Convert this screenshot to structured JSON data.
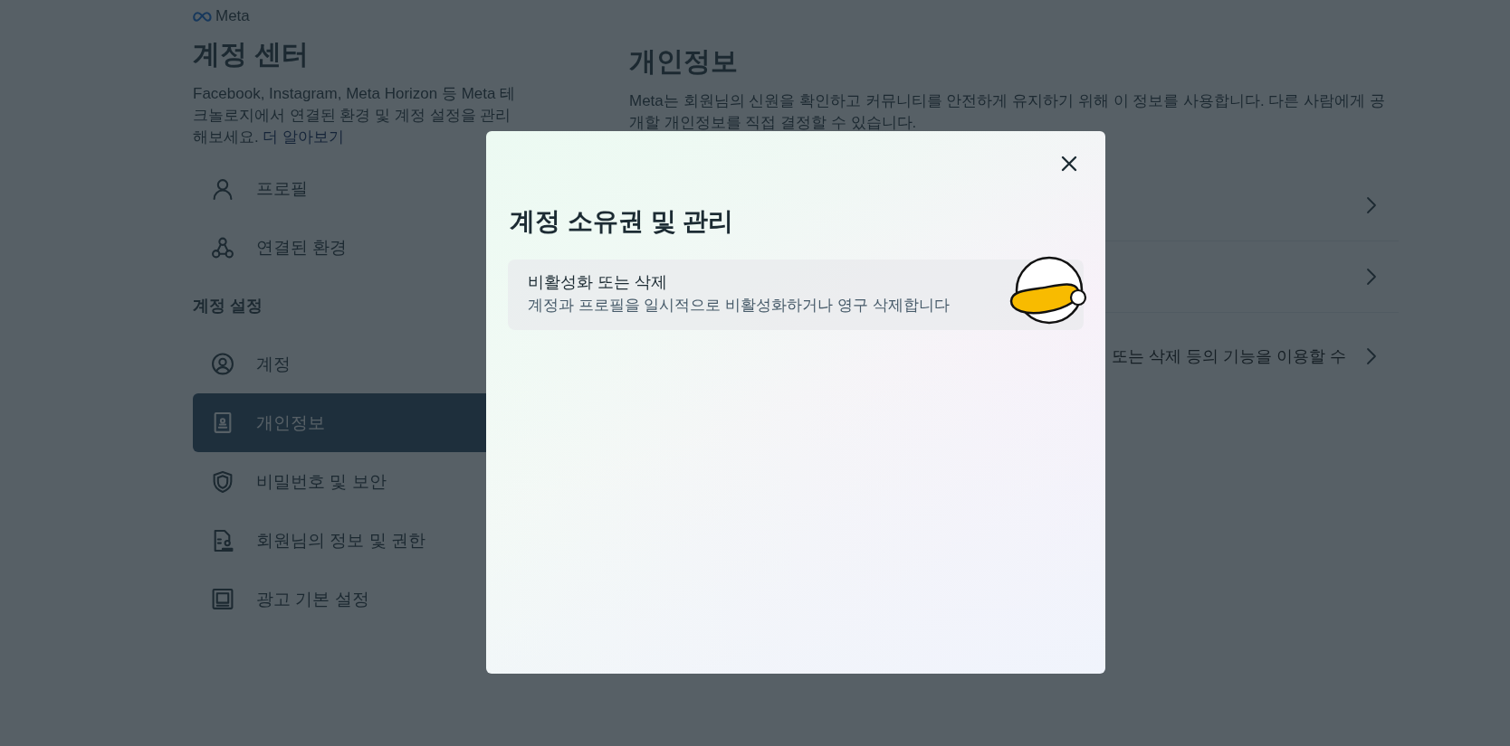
{
  "logo": {
    "text": "Meta"
  },
  "sidebar": {
    "title": "계정 센터",
    "description": "Facebook, Instagram, Meta Horizon 등 Meta 테크놀로지에서 연결된 환경 및 계정 설정을 관리해보세요.",
    "link": "더 알아보기",
    "items": [
      {
        "kind": "item",
        "label": "프로필",
        "selected": false
      },
      {
        "kind": "item",
        "label": "연결된 환경",
        "selected": false
      },
      {
        "kind": "heading",
        "label": "계정 설정"
      },
      {
        "kind": "item",
        "label": "계정",
        "selected": false
      },
      {
        "kind": "item",
        "label": "개인정보",
        "selected": true
      },
      {
        "kind": "item",
        "label": "비밀번호 및 보안",
        "selected": false
      },
      {
        "kind": "item",
        "label": "회원님의 정보 및 권한",
        "selected": false
      },
      {
        "kind": "item",
        "label": "광고 기본 설정",
        "selected": false
      }
    ]
  },
  "main": {
    "title": "개인정보",
    "description": "Meta는 회원님의 신원을 확인하고 커뮤니티를 안전하게 유지하기 위해 이 정보를 사용합니다. 다른 사람에게 공개할 개인정보를 직접 결정할 수 있습니다.",
    "rows": [
      {
        "kind": "link"
      },
      {
        "kind": "link"
      },
      {
        "kind": "link",
        "text": "또는 삭제 등의 기능을 이용할 수"
      }
    ]
  },
  "dialog": {
    "title": "계정 소유권 및 관리",
    "options": [
      {
        "title": "비활성화 또는 삭제",
        "description": "계정과 프로필을 일시적으로 비활성화하거나 영구 삭제합니다"
      }
    ]
  }
}
